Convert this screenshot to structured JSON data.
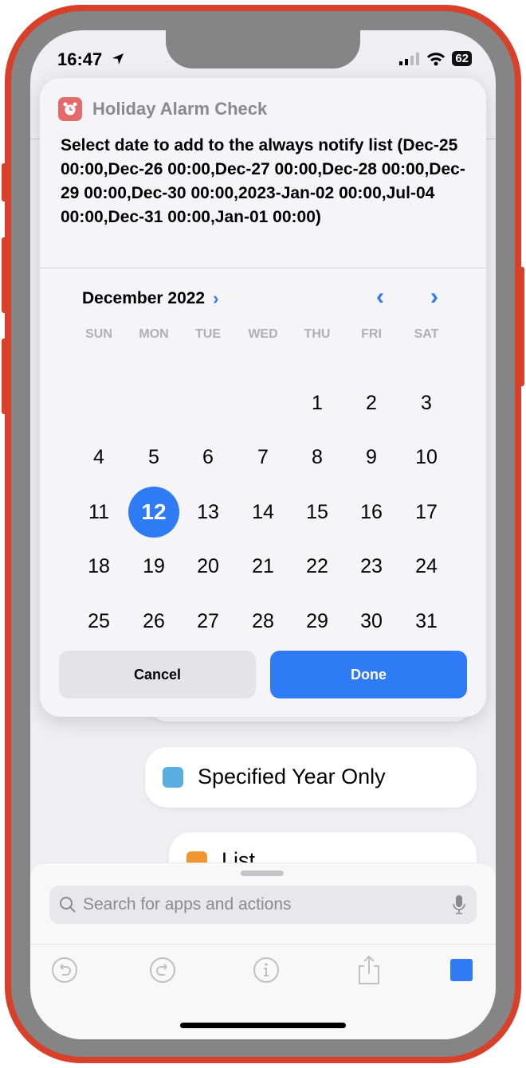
{
  "status_bar": {
    "time": "16:47",
    "battery": "62"
  },
  "dialog": {
    "app_name": "Holiday Alarm Check",
    "prompt": "Select date to add to the always notify list (Dec-25 00:00,Dec-26 00:00,Dec-27 00:00,Dec-28 00:00,Dec-29 00:00,Dec-30 00:00,2023-Jan-02 00:00,Jul-04 00:00,Dec-31 00:00,Jan-01 00:00)",
    "calendar": {
      "month_label": "December 2022",
      "weekdays": [
        "SUN",
        "MON",
        "TUE",
        "WED",
        "THU",
        "FRI",
        "SAT"
      ],
      "weeks": [
        [
          null,
          null,
          null,
          null,
          1,
          2,
          3
        ],
        [
          4,
          5,
          6,
          7,
          8,
          9,
          10
        ],
        [
          11,
          12,
          13,
          14,
          15,
          16,
          17
        ],
        [
          18,
          19,
          20,
          21,
          22,
          23,
          24
        ],
        [
          25,
          26,
          27,
          28,
          29,
          30,
          31
        ]
      ],
      "selected_day": 12
    },
    "cancel_label": "Cancel",
    "done_label": "Done"
  },
  "actions": [
    {
      "label": "Specified Year Only",
      "icon": "text-field-icon"
    },
    {
      "label": "List",
      "icon": "list-icon"
    }
  ],
  "search": {
    "placeholder": "Search for apps and actions"
  },
  "colors": {
    "accent": "#2f7af5",
    "app_icon": "#e46b6b"
  }
}
